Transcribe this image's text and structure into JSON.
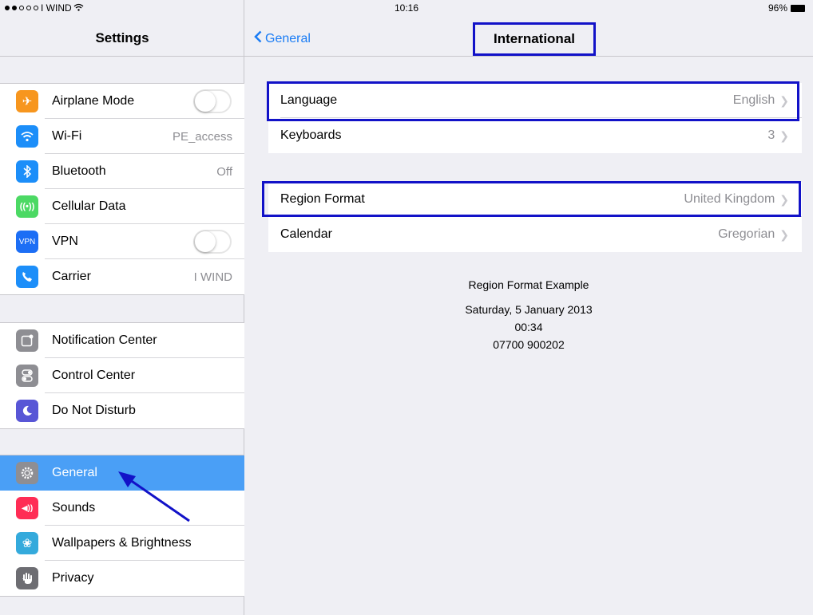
{
  "status": {
    "carrier": "I WIND",
    "time": "10:16",
    "battery": "96%"
  },
  "left": {
    "title": "Settings",
    "groups": [
      [
        {
          "label": "Airplane Mode",
          "icon": "airplane-icon",
          "color": "#f7961e",
          "toggle": true
        },
        {
          "label": "Wi-Fi",
          "value": "PE_access",
          "icon": "wifi-icon",
          "color": "#1c8ef9"
        },
        {
          "label": "Bluetooth",
          "value": "Off",
          "icon": "bluetooth-icon",
          "color": "#1c8ef9"
        },
        {
          "label": "Cellular Data",
          "icon": "cellular-icon",
          "color": "#4cd964"
        },
        {
          "label": "VPN",
          "icon": "vpn-icon",
          "color": "#1c6ef5",
          "toggle": true,
          "icon_text": "VPN"
        },
        {
          "label": "Carrier",
          "value": "I WIND",
          "icon": "phone-icon",
          "color": "#1c8ef9"
        }
      ],
      [
        {
          "label": "Notification Center",
          "icon": "notification-icon",
          "color": "#8e8e93"
        },
        {
          "label": "Control Center",
          "icon": "control-center-icon",
          "color": "#8e8e93"
        },
        {
          "label": "Do Not Disturb",
          "icon": "moon-icon",
          "color": "#5856d6"
        }
      ],
      [
        {
          "label": "General",
          "icon": "gear-icon",
          "color": "#8e8e93",
          "selected": true
        },
        {
          "label": "Sounds",
          "icon": "speaker-icon",
          "color": "#ff2d55"
        },
        {
          "label": "Wallpapers & Brightness",
          "icon": "flower-icon",
          "color": "#34aadc"
        },
        {
          "label": "Privacy",
          "icon": "hand-icon",
          "color": "#6d6d72"
        }
      ]
    ]
  },
  "nav": {
    "back_label": "General",
    "title": "International"
  },
  "right": {
    "group1": [
      {
        "label": "Language",
        "value": "English"
      },
      {
        "label": "Keyboards",
        "value": "3"
      }
    ],
    "group2": [
      {
        "label": "Region Format",
        "value": "United Kingdom"
      },
      {
        "label": "Calendar",
        "value": "Gregorian"
      }
    ],
    "example": {
      "title": "Region Format Example",
      "date": "Saturday, 5 January 2013",
      "time": "00:34",
      "phone": "07700 900202"
    }
  },
  "colors": {
    "accent": "#1a7cf5",
    "highlight": "#1212c8",
    "selected_row": "#4a9ff6"
  }
}
